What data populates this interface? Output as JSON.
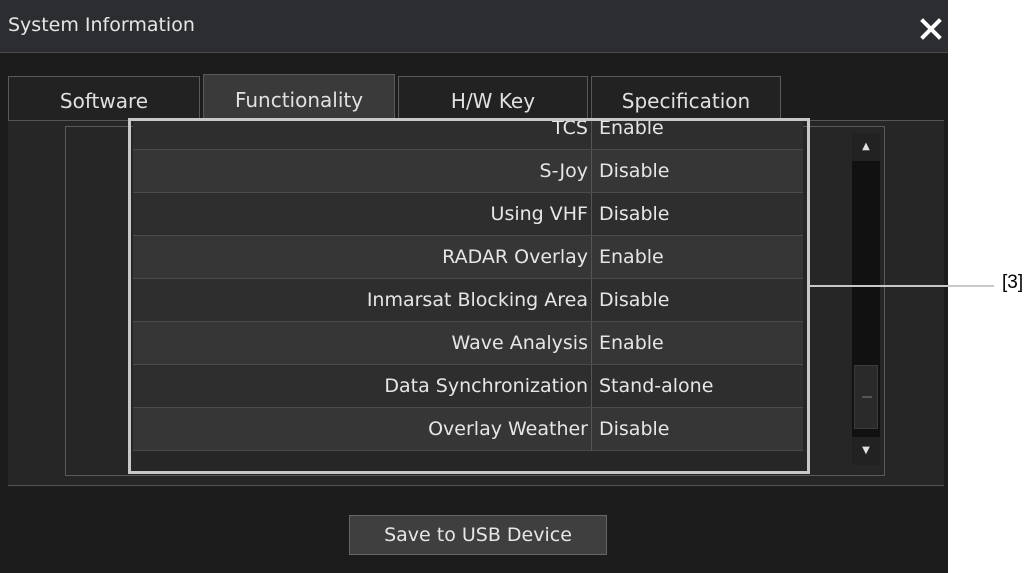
{
  "window": {
    "title": "System Information"
  },
  "tabs": [
    {
      "label": "Software"
    },
    {
      "label": "Functionality"
    },
    {
      "label": "H/W Key"
    },
    {
      "label": "Specification"
    }
  ],
  "function_list": [
    {
      "name": "TCS",
      "value": "Enable"
    },
    {
      "name": "S-Joy",
      "value": "Disable"
    },
    {
      "name": "Using VHF",
      "value": "Disable"
    },
    {
      "name": "RADAR Overlay",
      "value": "Enable"
    },
    {
      "name": "Inmarsat Blocking Area",
      "value": "Disable"
    },
    {
      "name": "Wave Analysis",
      "value": "Enable"
    },
    {
      "name": "Data Synchronization",
      "value": "Stand-alone"
    },
    {
      "name": "Overlay Weather",
      "value": "Disable"
    }
  ],
  "footer": {
    "save_button": "Save to USB Device"
  },
  "callout": {
    "label": "[3]"
  },
  "icons": {
    "close": "close-icon",
    "scroll_up": "triangle-up-icon",
    "scroll_down": "triangle-down-icon"
  },
  "colors": {
    "background": "#1c1c1c",
    "titlebar": "#2b2d31",
    "text": "#e6e6e6",
    "callout": "#c8c8c8"
  }
}
